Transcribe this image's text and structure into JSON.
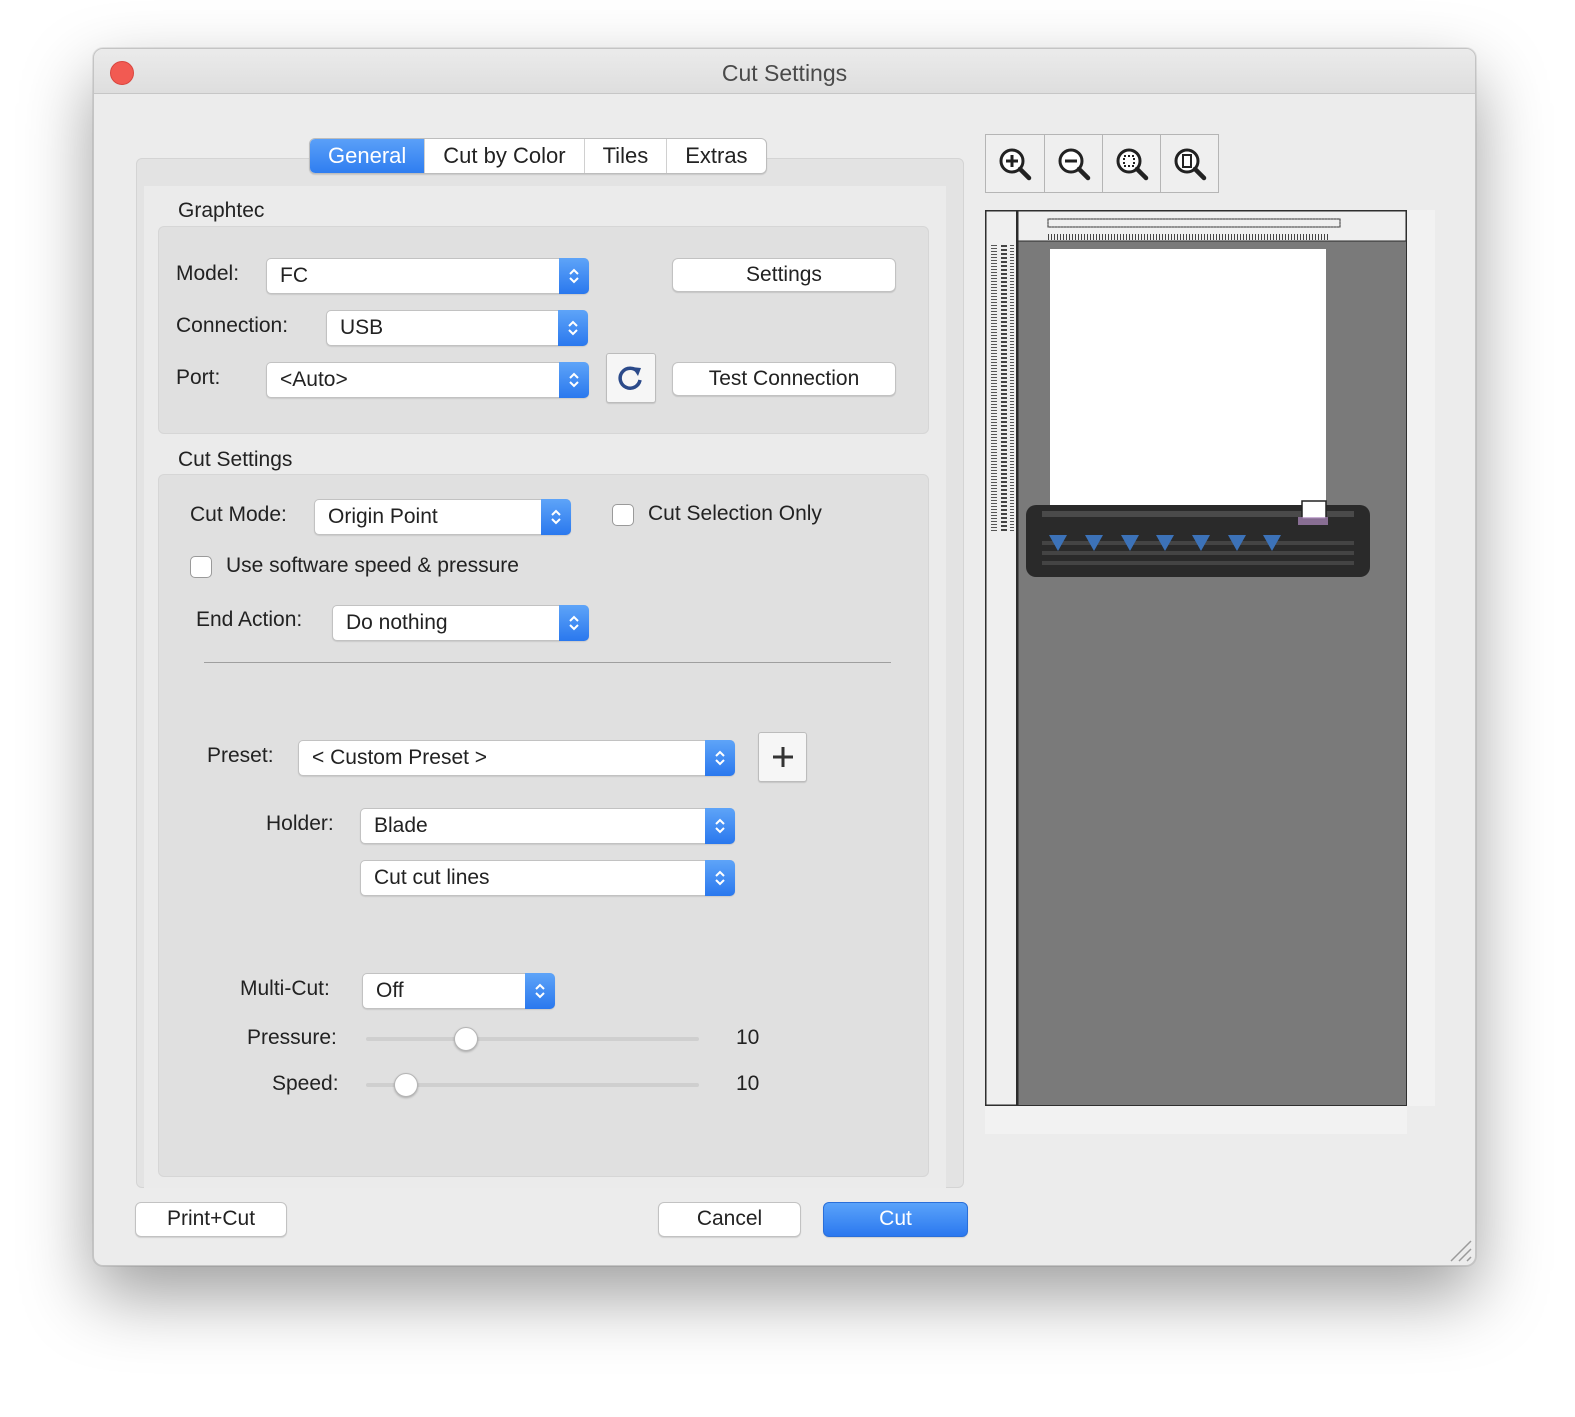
{
  "window": {
    "title": "Cut Settings"
  },
  "tabs": [
    {
      "label": "General",
      "active": true
    },
    {
      "label": "Cut by Color",
      "active": false
    },
    {
      "label": "Tiles",
      "active": false
    },
    {
      "label": "Extras",
      "active": false
    }
  ],
  "graphtec": {
    "group_label": "Graphtec",
    "model_label": "Model:",
    "model_value": "FC",
    "settings_button": "Settings",
    "connection_label": "Connection:",
    "connection_value": "USB",
    "port_label": "Port:",
    "port_value": "<Auto>",
    "refresh_icon": "refresh-icon",
    "test_connection_button": "Test Connection"
  },
  "cut_settings": {
    "group_label": "Cut Settings",
    "cut_mode_label": "Cut Mode:",
    "cut_mode_value": "Origin Point",
    "cut_selection_only_label": "Cut Selection Only",
    "cut_selection_only_checked": false,
    "use_software_label": "Use software speed & pressure",
    "use_software_checked": false,
    "end_action_label": "End Action:",
    "end_action_value": "Do nothing",
    "preset_label": "Preset:",
    "preset_value": "< Custom Preset >",
    "add_preset_icon": "plus-icon",
    "holder_label": "Holder:",
    "holder_value": "Blade",
    "holder_action_value": "Cut cut lines",
    "multicut_label": "Multi-Cut:",
    "multicut_value": "Off",
    "pressure_label": "Pressure:",
    "pressure_value": "10",
    "pressure_fraction": 0.3,
    "speed_label": "Speed:",
    "speed_value": "10",
    "speed_fraction": 0.12
  },
  "footer": {
    "print_cut_button": "Print+Cut",
    "cancel_button": "Cancel",
    "cut_button": "Cut"
  },
  "zoom_icons": [
    "zoom-in-icon",
    "zoom-out-icon",
    "zoom-fit-icon",
    "zoom-page-icon"
  ],
  "colors": {
    "accent": "#2f7ef0",
    "close_button": "#f25a52",
    "preview_background": "#7a7a7a",
    "cutter_marker": "#3c72b8"
  }
}
